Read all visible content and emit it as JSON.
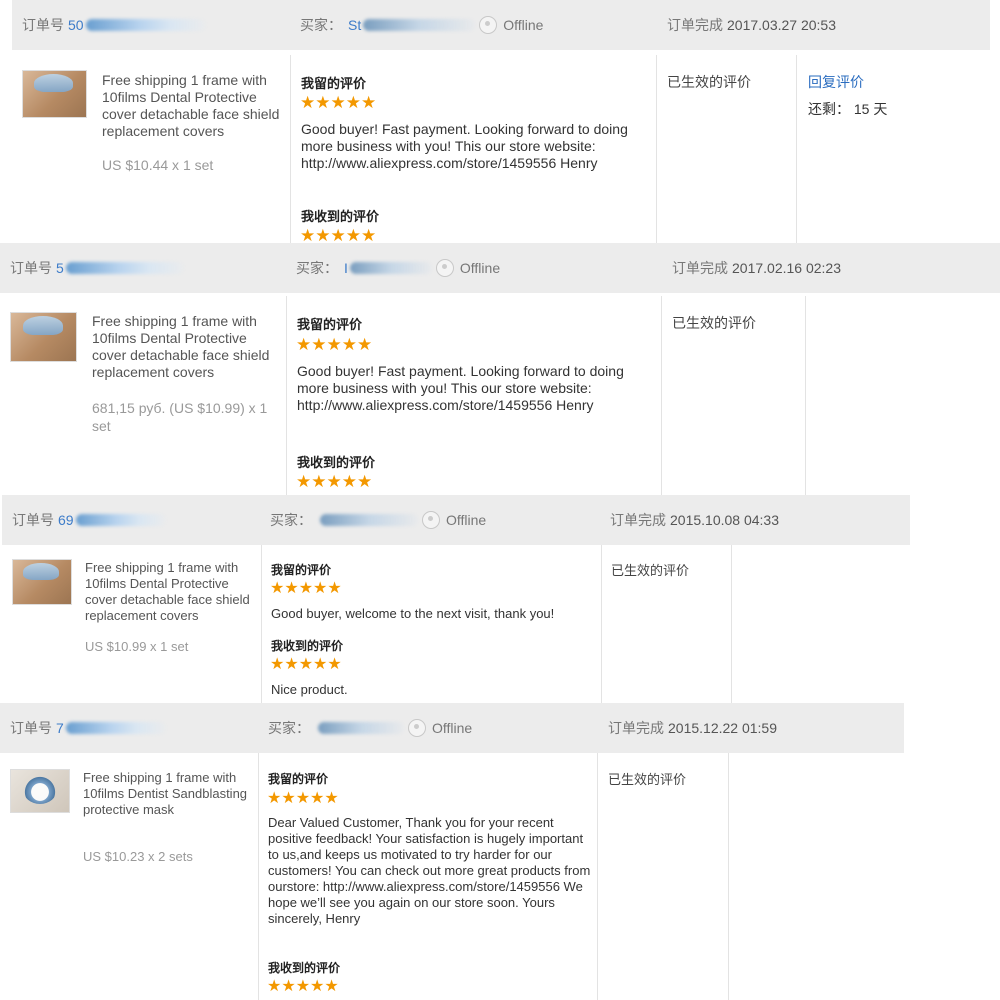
{
  "orders": [
    {
      "header": {
        "order_label": "订单号",
        "order_visible": "50",
        "buyer_label": "买家：",
        "buyer_visible": "St",
        "buyer_status": "Offline",
        "completed_label": "订单完成",
        "completed_date": "2017.03.27 20:53"
      },
      "product": {
        "title": "Free shipping 1 frame with 10films Dental Protective cover detachable face shield replacement covers",
        "price": "US $10.44 x 1 set"
      },
      "left_feedback": {
        "label": "我留的评价",
        "stars": "★★★★★",
        "text": "Good buyer! Fast payment. Looking forward to doing more business with you! This our store website: http://www.aliexpress.com/store/1459556 Henry"
      },
      "received_feedback": {
        "label": "我收到的评价",
        "stars": "★★★★★",
        "text": ""
      },
      "status": "已生效的评价",
      "reply_link": "回复评价",
      "remaining": "还剩： 15 天"
    },
    {
      "header": {
        "order_label": "订单号",
        "order_visible": "5",
        "buyer_label": "买家：",
        "buyer_visible": "I",
        "buyer_status": "Offline",
        "completed_label": "订单完成",
        "completed_date": "2017.02.16 02:23"
      },
      "product": {
        "title": "Free shipping 1 frame with 10films Dental Protective cover detachable face shield replacement covers",
        "price": "681,15 руб. (US $10.99) x 1 set"
      },
      "left_feedback": {
        "label": "我留的评价",
        "stars": "★★★★★",
        "text": "Good buyer! Fast payment. Looking forward to doing more business with you! This our store website: http://www.aliexpress.com/store/1459556 Henry"
      },
      "received_feedback": {
        "label": "我收到的评价",
        "stars": "★★★★★",
        "text": ""
      },
      "status": "已生效的评价"
    },
    {
      "header": {
        "order_label": "订单号",
        "order_visible": "69",
        "buyer_label": "买家：",
        "buyer_visible": "",
        "buyer_status": "Offline",
        "completed_label": "订单完成",
        "completed_date": "2015.10.08 04:33"
      },
      "product": {
        "title": "Free shipping 1 frame with 10films Dental Protective cover detachable face shield replacement covers",
        "price": "US $10.99 x 1 set"
      },
      "left_feedback": {
        "label": "我留的评价",
        "stars": "★★★★★",
        "text": "Good buyer, welcome to the next visit, thank you!"
      },
      "received_feedback": {
        "label": "我收到的评价",
        "stars": "★★★★★",
        "text": "Nice product."
      },
      "status": "已生效的评价"
    },
    {
      "header": {
        "order_label": "订单号",
        "order_visible": "7",
        "buyer_label": "买家：",
        "buyer_visible": "",
        "buyer_status": "Offline",
        "completed_label": "订单完成",
        "completed_date": "2015.12.22 01:59"
      },
      "product": {
        "title": "Free shipping 1 frame with 10films Dentist Sandblasting protective mask",
        "price": "US $10.23 x 2 sets"
      },
      "left_feedback": {
        "label": "我留的评价",
        "stars": "★★★★★",
        "text": "Dear Valued Customer, Thank you for your recent positive feedback! Your satisfaction is hugely important to us,and keeps us motivated to try harder for our customers! You can check out more great products from ourstore: http://www.aliexpress.com/store/1459556 We hope we’ll see you again on our store soon. Yours sincerely, Henry"
      },
      "received_feedback": {
        "label": "我收到的评价",
        "stars": "★★★★★",
        "text": ""
      },
      "status": "已生效的评价"
    }
  ],
  "colors": {
    "header_bg": "#ececec",
    "star": "#f39800",
    "link": "#2a6cbf",
    "order_number": "#3d7cc9"
  },
  "icons": {
    "buyer_account": "account-status-icon",
    "rating": "star-icon"
  }
}
